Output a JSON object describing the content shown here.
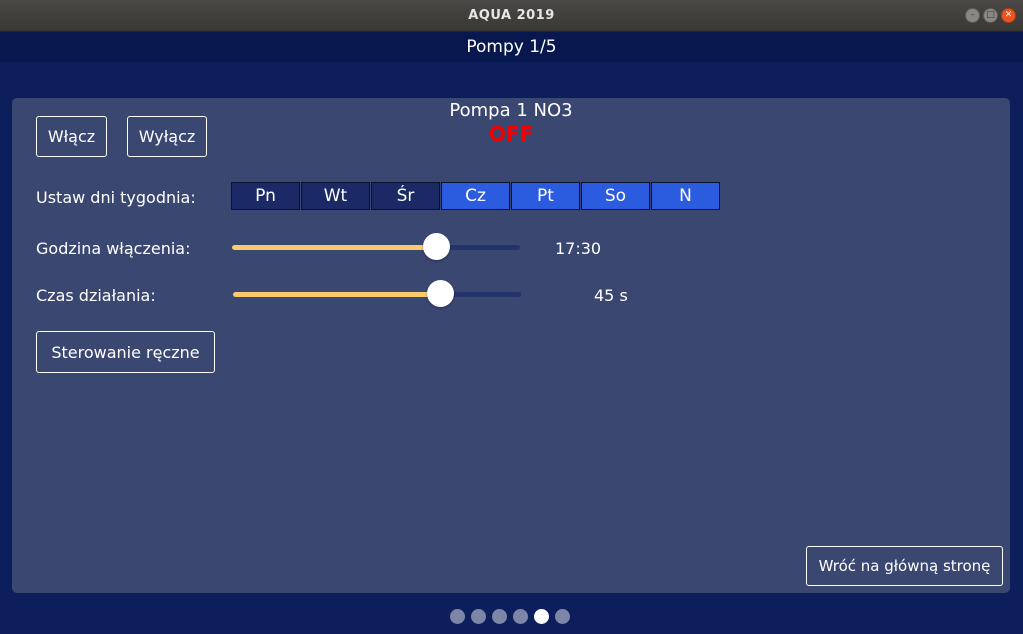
{
  "window": {
    "title": "AQUA 2019",
    "controls": [
      "minimize-icon",
      "maximize-icon",
      "close-icon"
    ]
  },
  "header": {
    "title": "Pompy 1/5"
  },
  "pump": {
    "name": "Pompa 1 NO3",
    "state": "OFF",
    "on_label": "Włącz",
    "off_label": "Wyłącz"
  },
  "days": {
    "label": "Ustaw dni tygodnia:",
    "items": [
      {
        "label": "Pn",
        "active": false
      },
      {
        "label": "Wt",
        "active": false
      },
      {
        "label": "Śr",
        "active": false
      },
      {
        "label": "Cz",
        "active": true
      },
      {
        "label": "Pt",
        "active": true
      },
      {
        "label": "So",
        "active": true
      },
      {
        "label": "N",
        "active": true
      }
    ]
  },
  "start_time": {
    "label": "Godzina włączenia:",
    "value": "17:30",
    "level": 0.71
  },
  "duration": {
    "label": "Czas działania:",
    "value": "45 s",
    "level": 0.72
  },
  "manual_button": "Sterowanie ręczne",
  "back_button": "Wróć na główną stronę",
  "pager": {
    "count": 6,
    "current": 5
  },
  "colors": {
    "background": "#0d1e5c",
    "panel": "#3a4771",
    "state_off": "#f40000",
    "day_active": "#2b5ce0",
    "day_inactive": "#1b2a66",
    "slider_fill": "#f9c96b"
  }
}
